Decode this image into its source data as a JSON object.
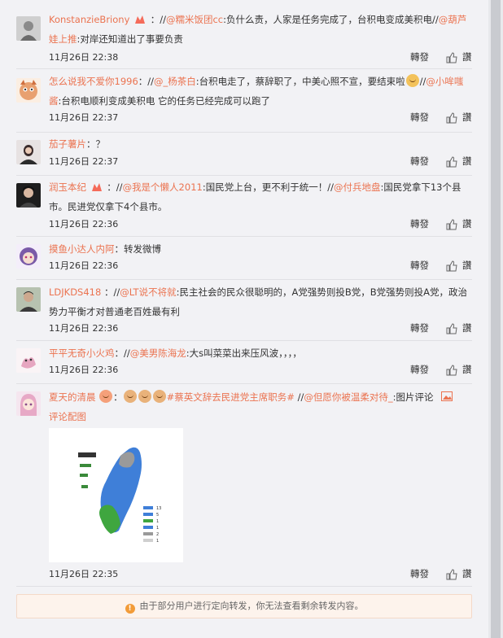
{
  "comments": [
    {
      "user": "KonstanzieBriony",
      "body_parts": [
        " ：//",
        "@糯米饭团cc",
        ":负什么责，人家是任务完成了，台积电变成美积电//",
        "@葫芦娃上推",
        ":对岸还知道出了事要负责"
      ],
      "time": "11月26日 22:38"
    },
    {
      "user": "怎么说我不爱你1996",
      "body_parts": [
        "：//",
        "@_杨茶白",
        ":台积电走了，蔡辞职了，中美心照不宣，要结束啦",
        "//",
        "@小哞嗤酱",
        ":台积电顺利变成美积电 它的任务已经完成可以跑了"
      ],
      "time": "11月26日 22:37"
    },
    {
      "user": "茄子薯片",
      "body_parts": [
        "：？"
      ],
      "time": "11月26日 22:37"
    },
    {
      "user": "润玉本纪",
      "body_parts": [
        " ：//",
        "@我是个懒人2011",
        ":国民党上台，更不利于统一！//",
        "@付兵地盘",
        ":国民党拿下13个县市。民进党仅拿下4个县市。"
      ],
      "time": "11月26日 22:36"
    },
    {
      "user": "摸鱼小达人内阿",
      "body_parts": [
        "：转发微博"
      ],
      "time": "11月26日 22:36"
    },
    {
      "user": "LDJKDS418",
      "body_parts": [
        " ：//",
        "@LT说不将就",
        ":民主社会的民众很聪明的，A党强势则投B党，B党强势则投A党，政治势力平衡才对普通老百姓最有利"
      ],
      "time": "11月26日 22:36"
    },
    {
      "user": "平平无奇小火鸡",
      "body_parts": [
        "：//",
        "@美男陈海龙",
        ":大s叫菜菜出来压风波，，，，"
      ],
      "time": "11月26日 22:36"
    },
    {
      "user": "夏天的清晨",
      "body_parts": [
        "：",
        "#蔡英文辞去民进党主席职务#",
        " //",
        "@但愿你被温柔对待_",
        ":图片评论 ",
        "评论配图"
      ],
      "time": "11月26日 22:35"
    }
  ],
  "actions": {
    "forward": "轉發",
    "like": "讚"
  },
  "map_legend": [
    "13",
    "5",
    "1",
    "1",
    "2",
    "1"
  ],
  "notice": "由于部分用户进行定向转发，你无法查看剩余转发内容。",
  "colors": {
    "link": "#eb7350",
    "notice_bg": "#fdf3ec"
  }
}
